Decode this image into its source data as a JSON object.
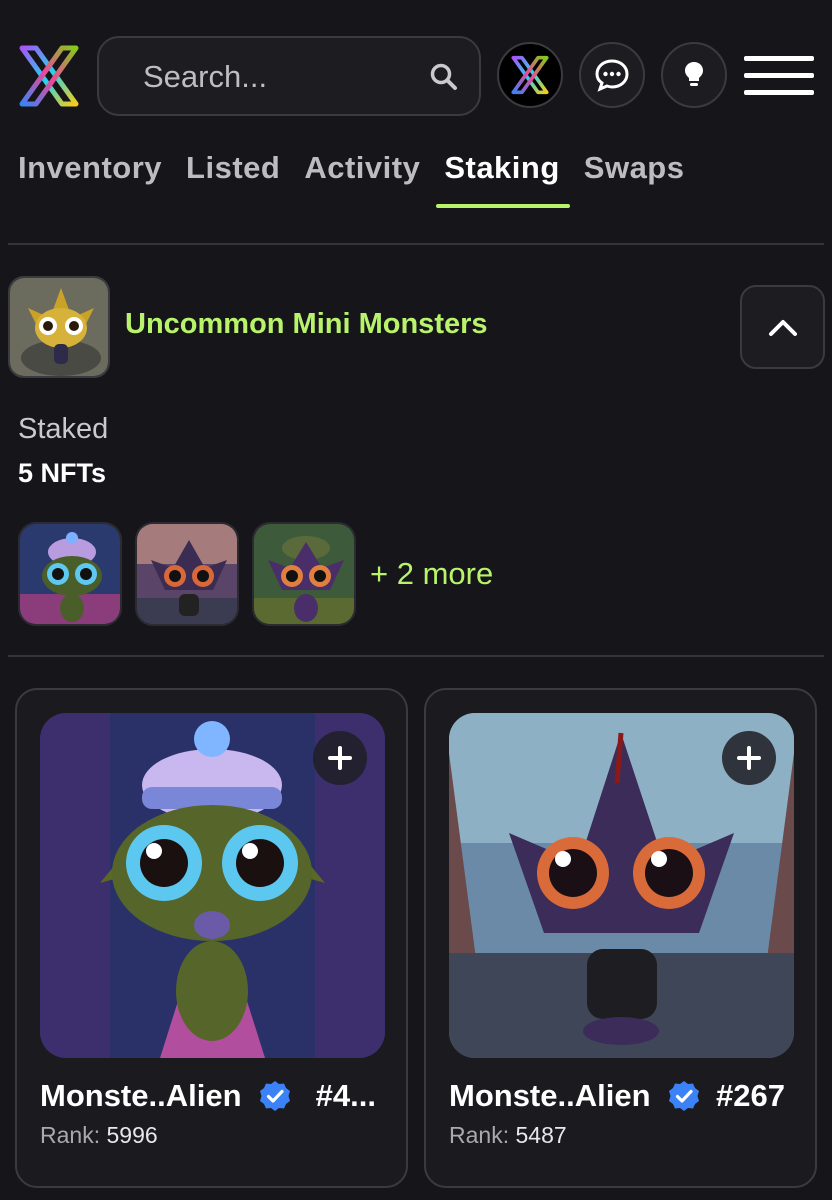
{
  "header": {
    "search_placeholder": "Search..."
  },
  "tabs": [
    {
      "label": "Inventory",
      "active": false
    },
    {
      "label": "Listed",
      "active": false
    },
    {
      "label": "Activity",
      "active": false
    },
    {
      "label": "Staking",
      "active": true
    },
    {
      "label": "Swaps",
      "active": false
    }
  ],
  "collection": {
    "name": "Uncommon Mini Monsters",
    "staked_label": "Staked",
    "staked_count": "5 NFTs",
    "more_label": "+ 2 more"
  },
  "cards": [
    {
      "title": "Monste..Alien",
      "id": "#4...",
      "rank_label": "Rank:",
      "rank_value": "5996"
    },
    {
      "title": "Monste..Alien",
      "id": "#267",
      "rank_label": "Rank:",
      "rank_value": "5487"
    }
  ],
  "colors": {
    "accent": "#b8f36b",
    "background": "#16161a",
    "verified": "#3b82f6"
  },
  "icons": [
    "app-logo-icon",
    "search-icon",
    "chat-icon",
    "lightbulb-icon",
    "hamburger-menu-icon",
    "chevron-up-icon",
    "plus-icon",
    "verified-badge-icon"
  ]
}
